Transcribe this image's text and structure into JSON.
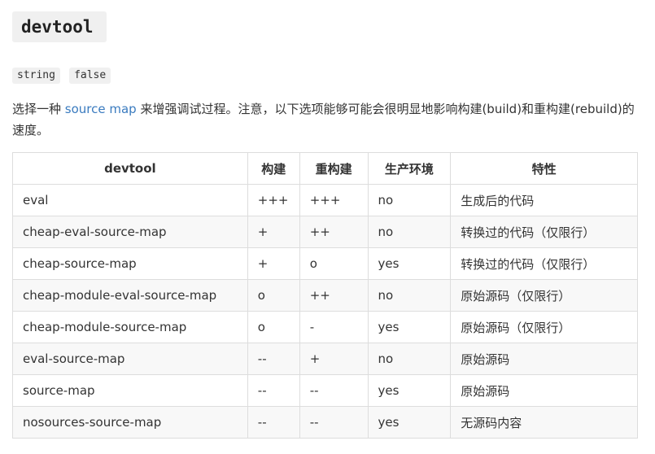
{
  "heading": "devtool",
  "types": [
    "string",
    "false"
  ],
  "description": {
    "before_link": "选择一种 ",
    "link_text": "source map",
    "after_link": " 来增强调试过程。注意，以下选项能够可能会很明显地影响构建(build)和重构建(rebuild)的速度。"
  },
  "table": {
    "headers": [
      "devtool",
      "构建",
      "重构建",
      "生产环境",
      "特性"
    ],
    "rows": [
      [
        "eval",
        "+++",
        "+++",
        "no",
        "生成后的代码"
      ],
      [
        "cheap-eval-source-map",
        "+",
        "++",
        "no",
        "转换过的代码（仅限行）"
      ],
      [
        "cheap-source-map",
        "+",
        "o",
        "yes",
        "转换过的代码（仅限行）"
      ],
      [
        "cheap-module-eval-source-map",
        "o",
        "++",
        "no",
        "原始源码（仅限行）"
      ],
      [
        "cheap-module-source-map",
        "o",
        "-",
        "yes",
        "原始源码（仅限行）"
      ],
      [
        "eval-source-map",
        "--",
        "+",
        "no",
        "原始源码"
      ],
      [
        "source-map",
        "--",
        "--",
        "yes",
        "原始源码"
      ],
      [
        "nosources-source-map",
        "--",
        "--",
        "yes",
        "无源码内容"
      ]
    ]
  }
}
